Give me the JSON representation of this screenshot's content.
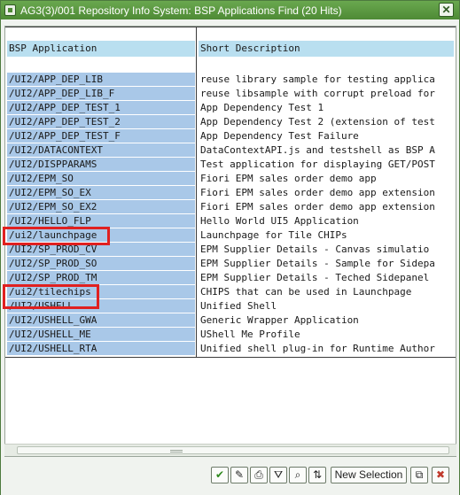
{
  "window": {
    "title": "AG3(3)/001 Repository Info System: BSP Applications Find (20 Hits)",
    "close_glyph": "✕"
  },
  "table": {
    "headers": {
      "app": "BSP Application",
      "desc": "Short Description"
    },
    "rows": [
      {
        "app": "/UI2/APP_DEP_LIB",
        "desc": "reuse library sample for testing applica"
      },
      {
        "app": "/UI2/APP_DEP_LIB_F",
        "desc": "reuse libsample with corrupt preload for"
      },
      {
        "app": "/UI2/APP_DEP_TEST_1",
        "desc": "App Dependency Test 1"
      },
      {
        "app": "/UI2/APP_DEP_TEST_2",
        "desc": "App Dependency Test 2 (extension of test"
      },
      {
        "app": "/UI2/APP_DEP_TEST_F",
        "desc": "App Dependency Test Failure"
      },
      {
        "app": "/UI2/DATACONTEXT",
        "desc": "DataContextAPI.js and testshell as BSP A"
      },
      {
        "app": "/UI2/DISPPARAMS",
        "desc": "Test application for displaying GET/POST"
      },
      {
        "app": "/UI2/EPM_SO",
        "desc": "Fiori EPM sales order demo app"
      },
      {
        "app": "/UI2/EPM_SO_EX",
        "desc": "Fiori EPM sales order demo app extension"
      },
      {
        "app": "/UI2/EPM_SO_EX2",
        "desc": "Fiori EPM sales order demo app extension"
      },
      {
        "app": "/UI2/HELLO_FLP",
        "desc": "Hello World UI5 Application"
      },
      {
        "app": "/ui2/launchpage",
        "desc": "Launchpage for Tile CHIPs"
      },
      {
        "app": "/UI2/SP_PROD_CV",
        "desc": "EPM Supplier Details -  Canvas simulatio"
      },
      {
        "app": "/UI2/SP_PROD_SO",
        "desc": "EPM Supplier Details -  Sample for Sidepa"
      },
      {
        "app": "/UI2/SP_PROD_TM",
        "desc": "EPM Supplier Details - Teched Sidepanel"
      },
      {
        "app": "/ui2/tilechips",
        "desc": "CHIPS that can be used in Launchpage"
      },
      {
        "app": "/UI2/USHELL",
        "desc": "Unified Shell"
      },
      {
        "app": "/UI2/USHELL_GWA",
        "desc": "Generic Wrapper Application"
      },
      {
        "app": "/UI2/USHELL_ME",
        "desc": "UShell Me Profile"
      },
      {
        "app": "/UI2/USHELL_RTA",
        "desc": "Unified shell plug-in for Runtime Author"
      }
    ]
  },
  "toolbar": {
    "confirm_glyph": "✔",
    "find_glyph": "✎",
    "print_glyph": "⎙",
    "filter_glyph": "⛛",
    "find_next_glyph": "⌕",
    "sort_glyph": "⇅",
    "new_selection_label": "New Selection",
    "copy_glyph": "⧉",
    "cancel_glyph": "✖"
  },
  "colors": {
    "titlebar": "#4e8a35",
    "app_cell_bg": "#a9c8e8",
    "header_bg": "#b9dff0",
    "highlight_border": "#e02020"
  }
}
